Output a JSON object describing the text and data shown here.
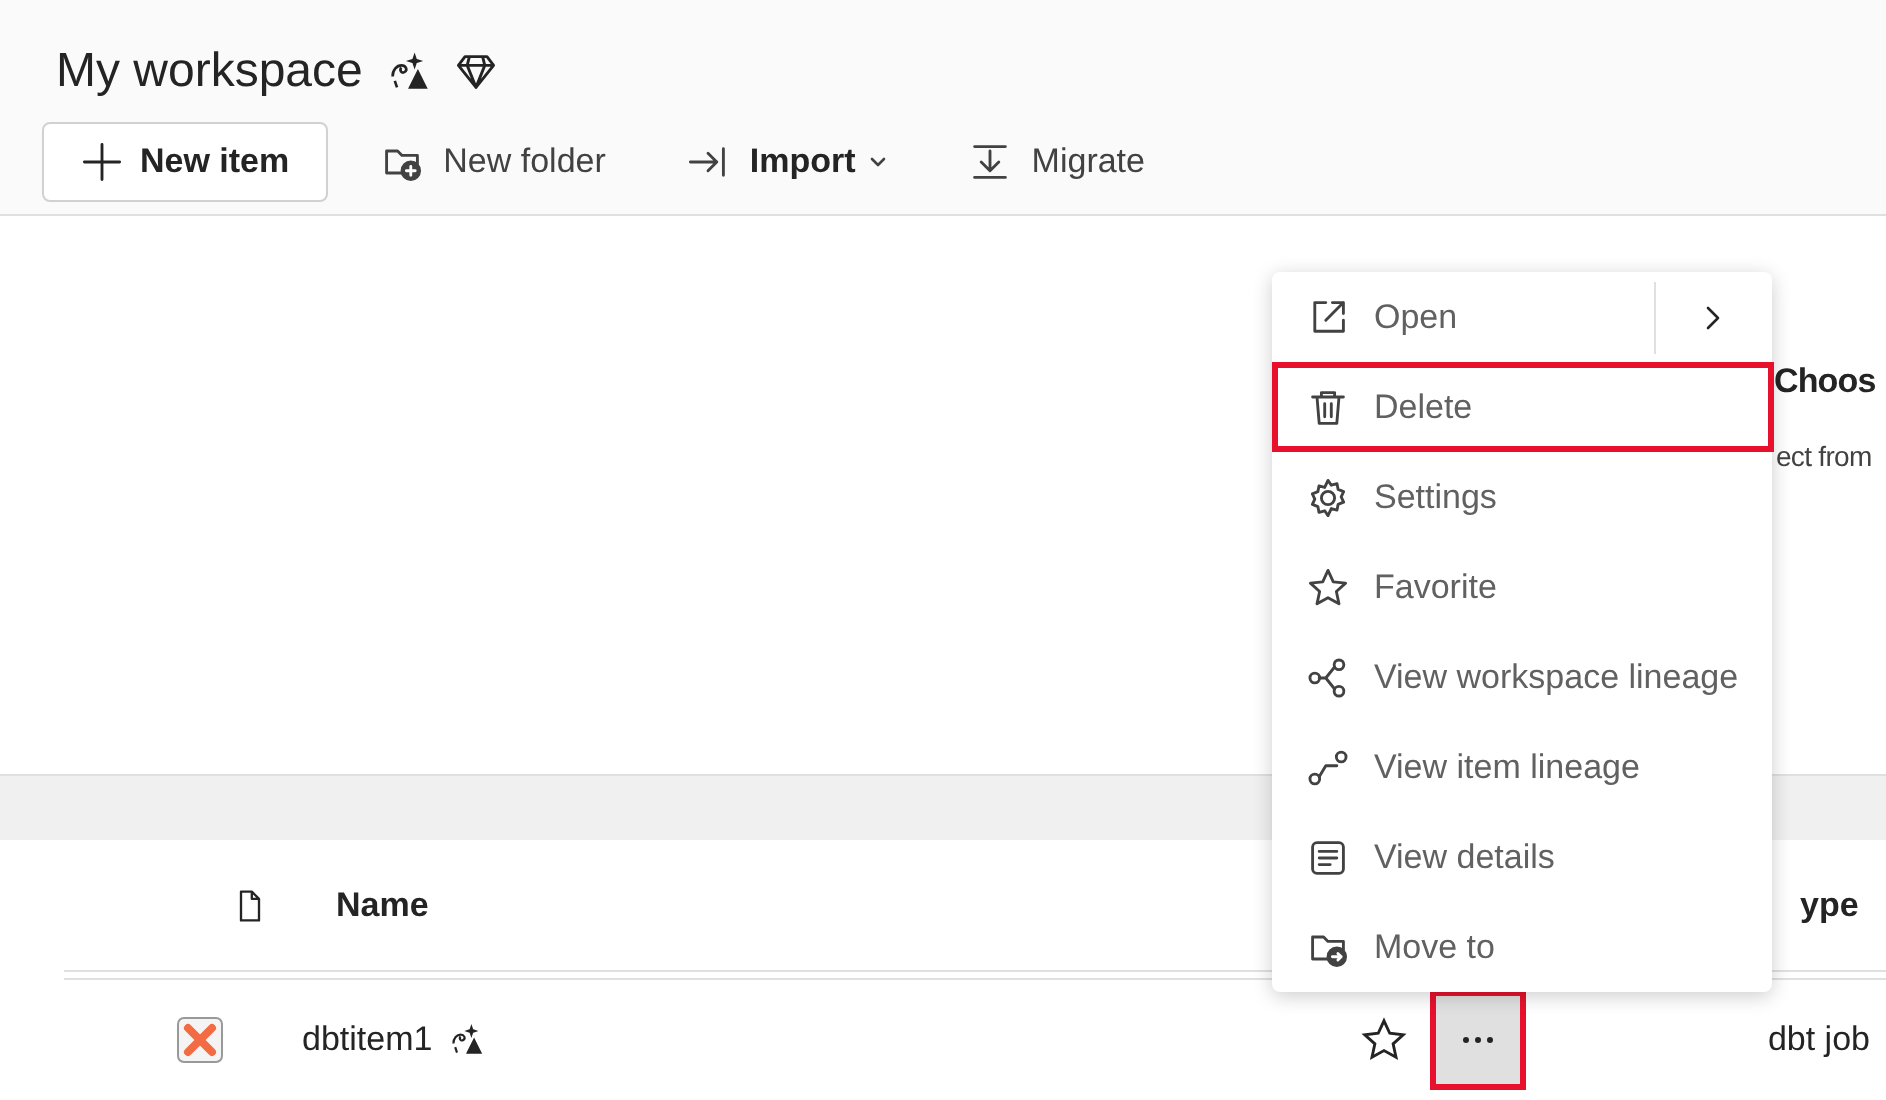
{
  "title": "My workspace",
  "toolbar": [
    {
      "kind": "primary",
      "label": "New item"
    },
    {
      "kind": "plain",
      "label": "New folder"
    },
    {
      "kind": "dropdown",
      "label": "Import"
    },
    {
      "kind": "plain",
      "label": "Migrate"
    }
  ],
  "banner": {
    "heading": "Choos",
    "text": "ect from"
  },
  "table": {
    "columns": [
      {
        "label": "Name"
      },
      {
        "label": "ype"
      }
    ],
    "rows": [
      {
        "name": "dbtitem1",
        "favorite": false,
        "type": "dbt job",
        "more_highlighted": true
      }
    ]
  },
  "context_menu": [
    {
      "label": "Open",
      "submenu": true,
      "highlighted": false
    },
    {
      "label": "Delete",
      "submenu": false,
      "highlighted": true
    },
    {
      "label": "Settings",
      "submenu": false,
      "highlighted": false
    },
    {
      "label": "Favorite",
      "submenu": false,
      "highlighted": false
    },
    {
      "label": "View workspace lineage",
      "submenu": false,
      "highlighted": false
    },
    {
      "label": "View item lineage",
      "submenu": false,
      "highlighted": false
    },
    {
      "label": "View details",
      "submenu": false,
      "highlighted": false
    },
    {
      "label": "Move to",
      "submenu": false,
      "highlighted": false
    }
  ]
}
